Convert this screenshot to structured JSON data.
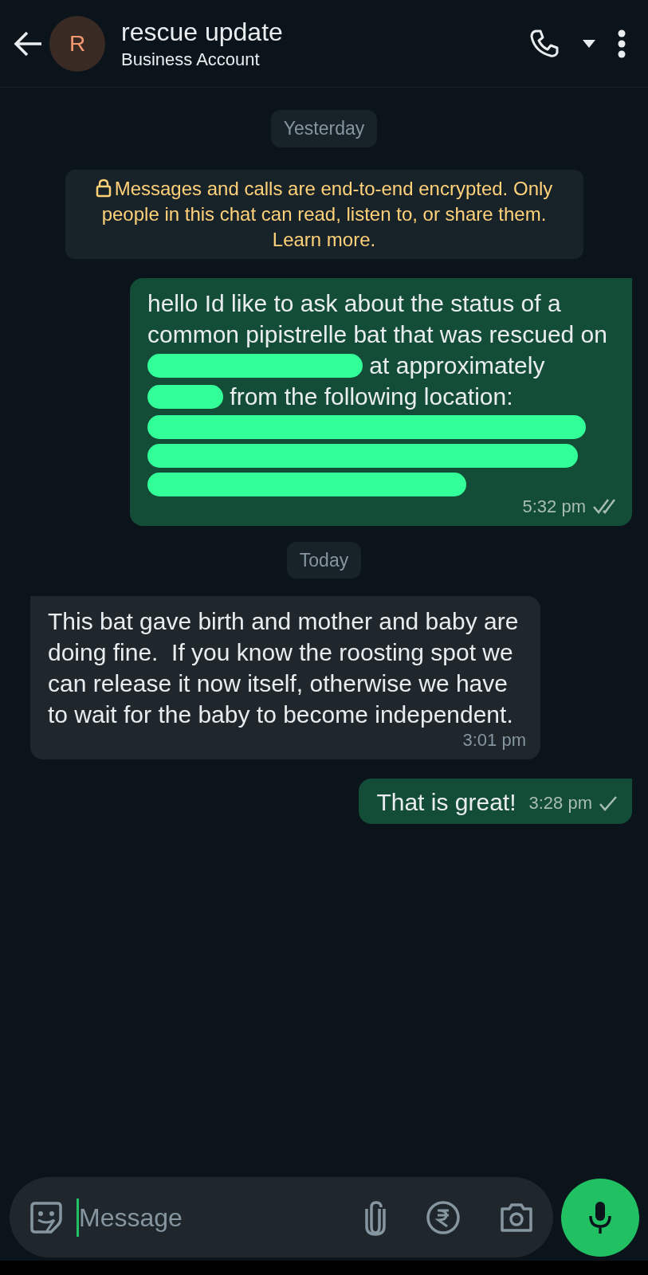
{
  "header": {
    "avatar_letter": "R",
    "title": "rescue update",
    "subtitle": "Business Account"
  },
  "items": [
    {
      "kind": "date",
      "text": "Yesterday"
    },
    {
      "kind": "notice",
      "text": "Messages and calls are end-to-end encrypted. Only people in this chat can read, listen to, or share them. Learn more."
    },
    {
      "kind": "outgoing",
      "parts": [
        {
          "kind": "text",
          "text": "hello Id like to ask about the status of a common pipistrelle bat that was rescued on"
        },
        {
          "kind": "mark"
        },
        {
          "kind": "text",
          "text": "at approximately"
        },
        {
          "kind": "mark"
        },
        {
          "kind": "text",
          "text": "from the following location:"
        },
        {
          "kind": "block"
        }
      ],
      "time": "5:32 pm",
      "delivered": true
    },
    {
      "kind": "date",
      "text": "Today"
    },
    {
      "kind": "incoming",
      "parts": [
        {
          "kind": "text",
          "text": "This bat gave birth and mother and baby are doing fine.  If you know the roosting spot we can release it now itself, otherwise we have to wait for the baby to become independent."
        }
      ],
      "time": "3:01 pm"
    },
    {
      "kind": "outgoing",
      "parts": [
        {
          "kind": "text",
          "text": "That is great!"
        }
      ],
      "time": "3:28 pm",
      "delivered": false
    }
  ],
  "composer": {
    "placeholder": "Message"
  }
}
